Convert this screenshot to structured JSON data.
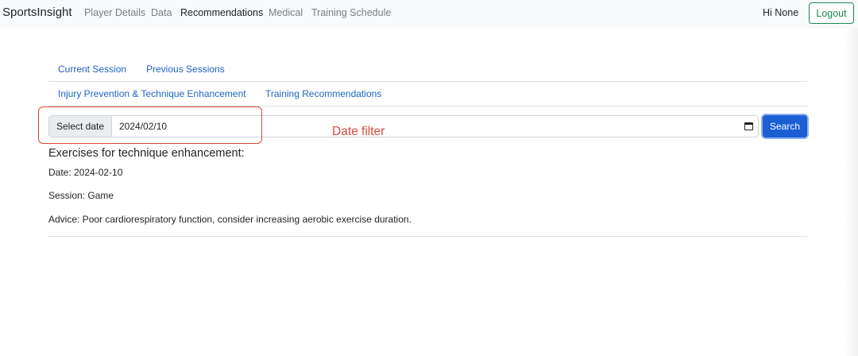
{
  "navbar": {
    "brand": "SportsInsight",
    "links": [
      {
        "label": "Player Details"
      },
      {
        "label": "Data"
      },
      {
        "label": "Recommendations"
      },
      {
        "label": "Medical"
      },
      {
        "label": "Training Schedule"
      }
    ],
    "greeting": "Hi None",
    "logout_label": "Logout"
  },
  "tabs_row1": [
    {
      "label": "Current Session"
    },
    {
      "label": "Previous Sessions"
    }
  ],
  "tabs_row2": [
    {
      "label": "Injury Prevention & Technique Enhancement"
    },
    {
      "label": "Training Recommendations"
    }
  ],
  "filter": {
    "label": "Select date",
    "value": "2024/02/10",
    "search_label": "Search"
  },
  "annotation": {
    "label": "Date filter",
    "color": "#d9483a"
  },
  "result": {
    "heading": "Exercises for technique enhancement:",
    "date_line": "Date: 2024-02-10",
    "session_line": "Session: Game",
    "advice_line": "Advice: Poor cardiorespiratory function, consider increasing aerobic exercise duration."
  },
  "colors": {
    "link": "#1f63c6",
    "primary": "#1b5fd3",
    "success": "#198754"
  }
}
